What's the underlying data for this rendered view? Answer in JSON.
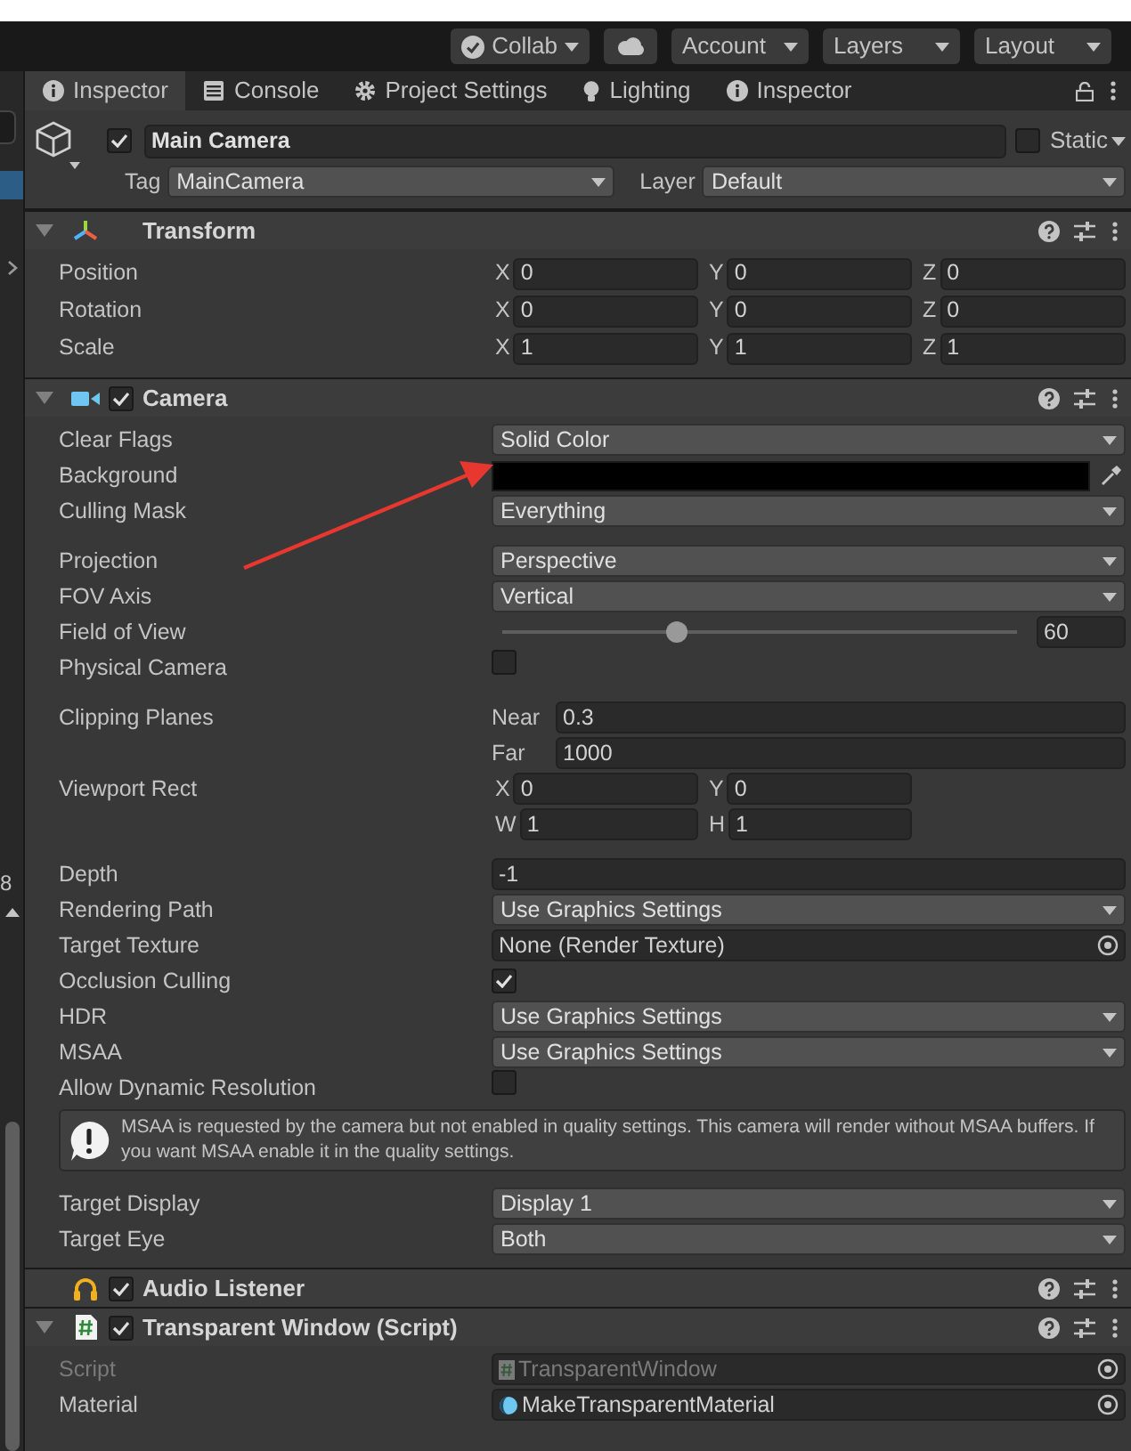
{
  "toolbar": {
    "buttons": [
      {
        "kind": "collab",
        "label": "Collab"
      },
      {
        "kind": "cloud"
      },
      {
        "kind": "menu",
        "label": "Account"
      },
      {
        "kind": "menu",
        "label": "Layers"
      },
      {
        "kind": "menu",
        "label": "Layout"
      }
    ]
  },
  "left_panel": {
    "number": "8"
  },
  "tabs": [
    {
      "label": "Inspector",
      "selected": true
    },
    {
      "label": "Console",
      "selected": false
    },
    {
      "label": "Project Settings",
      "selected": false
    },
    {
      "label": "Lighting",
      "selected": false
    },
    {
      "label": "Inspector",
      "selected": false
    }
  ],
  "object": {
    "active": true,
    "name": "Main Camera",
    "static": false,
    "static_label": "Static",
    "tag_label": "Tag",
    "tag": "MainCamera",
    "layer_label": "Layer",
    "layer": "Default"
  },
  "components": [
    {
      "name": "Transform",
      "expanded": true,
      "rows": [
        {
          "kind": "fields",
          "label": "Position",
          "fields": [
            {
              "axis": "X",
              "value": "0"
            },
            {
              "axis": "Y",
              "value": "0"
            },
            {
              "axis": "Z",
              "value": "0"
            }
          ]
        },
        {
          "kind": "fields",
          "label": "Rotation",
          "fields": [
            {
              "axis": "X",
              "value": "0"
            },
            {
              "axis": "Y",
              "value": "0"
            },
            {
              "axis": "Z",
              "value": "0"
            }
          ]
        },
        {
          "kind": "fields",
          "label": "Scale",
          "fields": [
            {
              "axis": "X",
              "value": "1"
            },
            {
              "axis": "Y",
              "value": "1"
            },
            {
              "axis": "Z",
              "value": "1"
            }
          ]
        }
      ]
    },
    {
      "name": "Camera",
      "enabled": true,
      "expanded": true,
      "rows": [
        {
          "kind": "dropdown",
          "label": "Clear Flags",
          "value": "Solid Color"
        },
        {
          "kind": "color",
          "label": "Background",
          "color": "#000000"
        },
        {
          "kind": "dropdown",
          "label": "Culling Mask",
          "value": "Everything"
        },
        {
          "kind": "space"
        },
        {
          "kind": "dropdown",
          "label": "Projection",
          "value": "Perspective"
        },
        {
          "kind": "dropdown",
          "label": "FOV Axis",
          "value": "Vertical"
        },
        {
          "kind": "slider",
          "label": "Field of View",
          "level": 0.34,
          "value": "60"
        },
        {
          "kind": "checkbox",
          "label": "Physical Camera",
          "checked": false
        },
        {
          "kind": "space"
        },
        {
          "kind": "fields",
          "label": "Clipping Planes",
          "fields": [
            {
              "axis": "Near",
              "value": "0.3"
            }
          ]
        },
        {
          "kind": "fields",
          "fields": [
            {
              "axis": "Far",
              "value": "1000"
            }
          ]
        },
        {
          "kind": "fields",
          "label": "Viewport Rect",
          "fields": [
            {
              "axis": "X",
              "value": "0"
            },
            {
              "axis": "Y",
              "value": "0"
            }
          ]
        },
        {
          "kind": "fields",
          "fields": [
            {
              "axis": "W",
              "value": "1"
            },
            {
              "axis": "H",
              "value": "1"
            }
          ]
        },
        {
          "kind": "space"
        },
        {
          "kind": "text",
          "label": "Depth",
          "value": "-1"
        },
        {
          "kind": "dropdown",
          "label": "Rendering Path",
          "value": "Use Graphics Settings"
        },
        {
          "kind": "object",
          "label": "Target Texture",
          "value": "None (Render Texture)",
          "disabled": false
        },
        {
          "kind": "checkbox",
          "label": "Occlusion Culling",
          "checked": true
        },
        {
          "kind": "dropdown",
          "label": "HDR",
          "value": "Use Graphics Settings"
        },
        {
          "kind": "dropdown",
          "label": "MSAA",
          "value": "Use Graphics Settings"
        },
        {
          "kind": "checkbox",
          "label": "Allow Dynamic Resolution",
          "checked": false
        },
        {
          "kind": "help",
          "text": "MSAA is requested by the camera but not enabled in quality settings. This camera will render without MSAA buffers. If you want MSAA enable it in the quality settings."
        },
        {
          "kind": "dropdown",
          "label": "Target Display",
          "value": "Display 1"
        },
        {
          "kind": "dropdown",
          "label": "Target Eye",
          "value": "Both"
        }
      ]
    },
    {
      "name": "Audio Listener",
      "enabled": true
    },
    {
      "name": "Transparent Window (Script)",
      "enabled": true,
      "expanded": true,
      "rows": [
        {
          "kind": "script",
          "label": "Script",
          "value": "TransparentWindow",
          "disabled": true
        },
        {
          "kind": "material",
          "label": "Material",
          "value": "MakeTransparentMaterial",
          "disabled": false
        }
      ]
    }
  ]
}
